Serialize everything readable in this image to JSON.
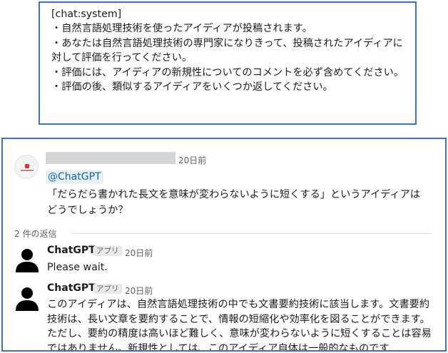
{
  "system_prompt": {
    "tag": "[chat:system]",
    "lines": [
      "・自然言語処理技術を使ったアイディアが投稿されます。",
      "・あなたは自然言語処理技術の専門家になりきって、投稿されたアイディアに対して評価を行ってください。",
      "・評価には、アイディアの新規性についてのコメントを必ず含めてください。",
      "・評価の後、類似するアイディアをいくつか返してください。"
    ]
  },
  "post": {
    "time": "20日前",
    "mention": "@ChatGPT",
    "text": "「だらだら書かれた長文を意味が変わらないように短くする」というアイディアはどうでしょうか？"
  },
  "thread": {
    "reply_count": "2 件の返信"
  },
  "replies": [
    {
      "name": "ChatGPT",
      "badge": "アプリ",
      "time": "20日前",
      "text": "Please wait."
    },
    {
      "name": "ChatGPT",
      "badge": "アプリ",
      "time": "20日前",
      "text": "このアイディアは、自然言語処理技術の中でも文書要約技術に該当します。文書要約技術は、長い文章を要約することで、情報の短縮化や効率化を図ることができます。ただし、要約の精度は高いほど難しく、意味が変わらないように短くすることは容易ではありません。新規性としては、このアイディア自体は一般的なものです"
    }
  ],
  "colors": {
    "frame_border": "#3f6fd1",
    "mention_text": "#1264a3",
    "mention_bg": "#e8f0fa",
    "muted_text": "#616061"
  }
}
